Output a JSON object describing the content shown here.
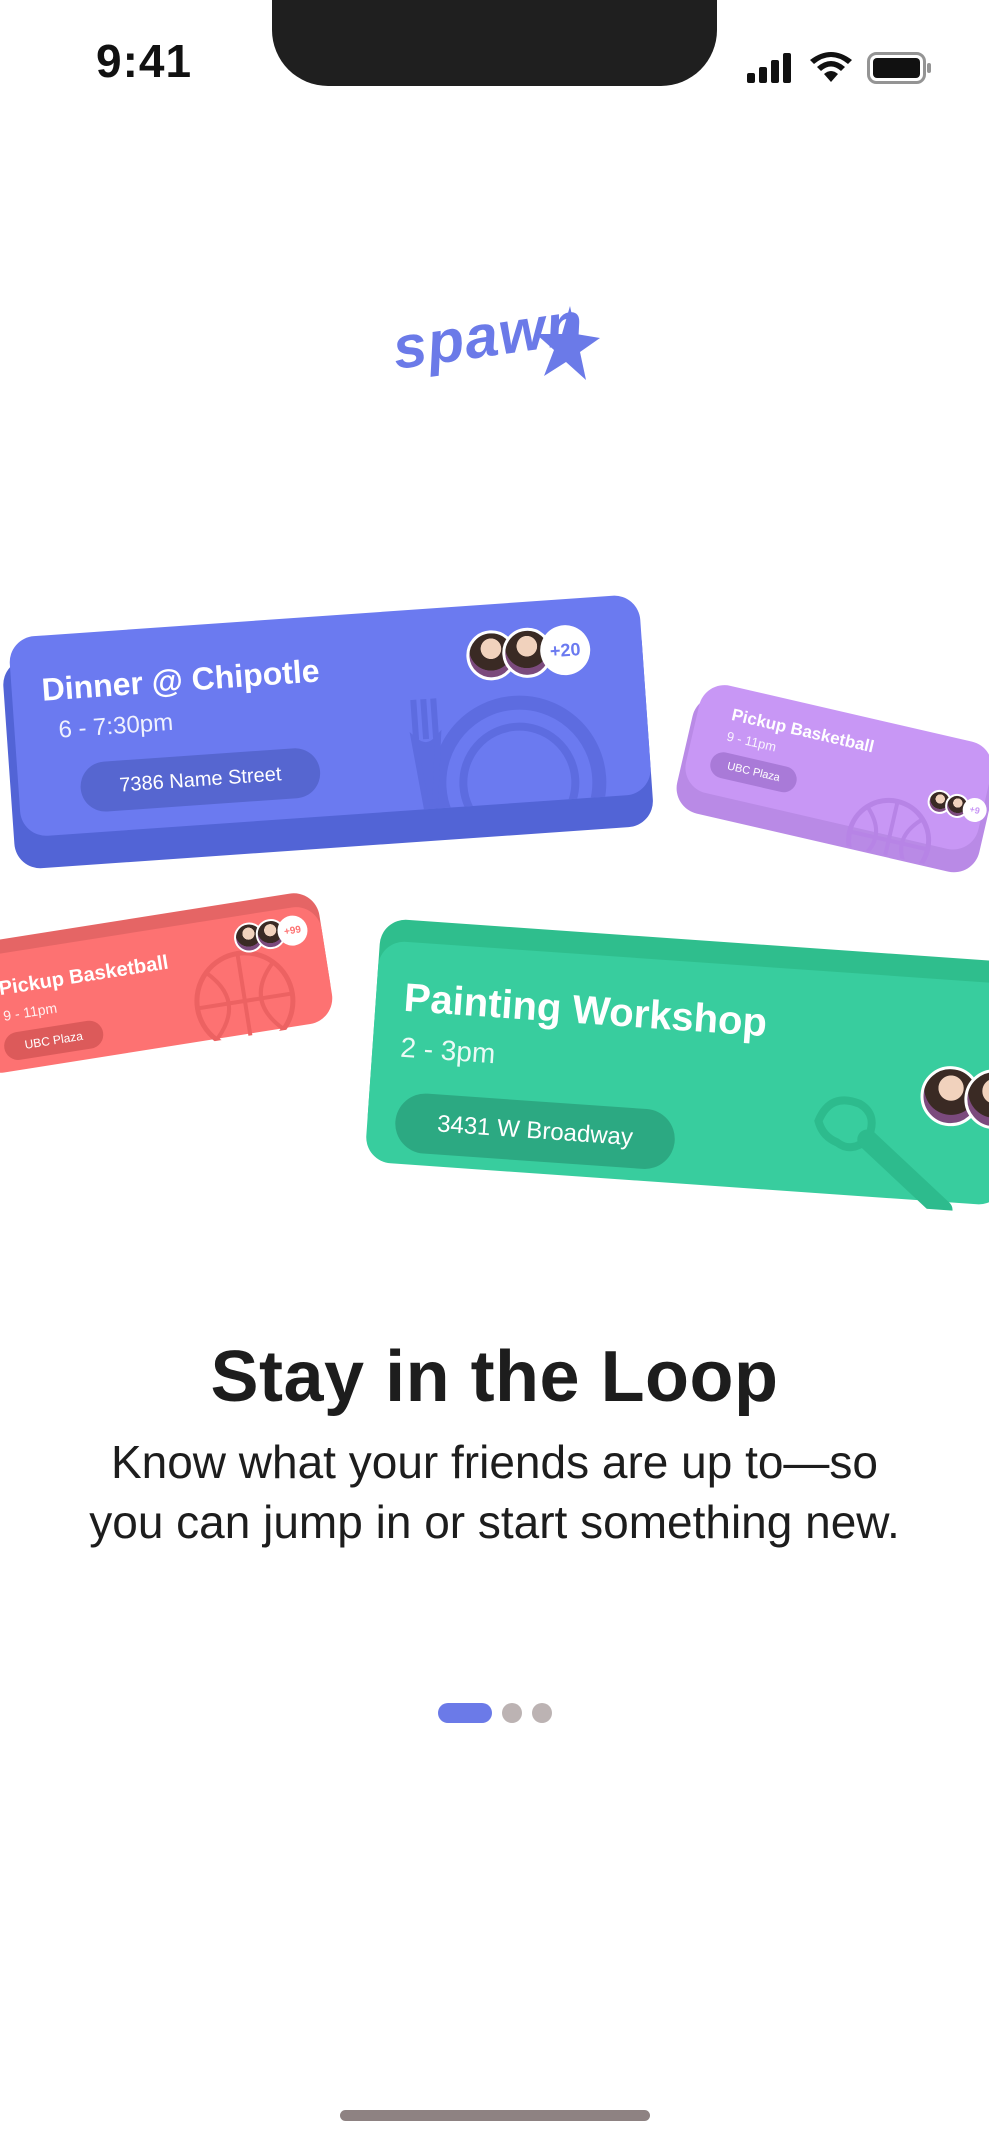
{
  "status_bar": {
    "time": "9:41"
  },
  "logo": {
    "text": "spawn"
  },
  "cards": [
    {
      "title": "Dinner @ Chipotle",
      "time": "6 - 7:30pm",
      "location": "7386 Name Street",
      "extra_count": "+20",
      "color": "#6b7af0",
      "icon": "dinner-plate-icon"
    },
    {
      "title": "Pickup Basketball",
      "time": "9 - 11pm",
      "location": "UBC Plaza",
      "extra_count": "+9",
      "color": "#c897f5",
      "icon": "basketball-icon"
    },
    {
      "title": "Pickup Basketball",
      "time": "9 - 11pm",
      "location": "UBC Plaza",
      "extra_count": "+99",
      "color": "#fd7272",
      "icon": "basketball-icon"
    },
    {
      "title": "Painting Workshop",
      "time": "2 - 3pm",
      "location": "3431 W Broadway",
      "color": "#38cd9e",
      "icon": "paintbrush-icon"
    }
  ],
  "onboarding": {
    "headline": "Stay in the Loop",
    "subtext": "Know what your friends are up to—so you can jump in or start something new.",
    "page_count": 3,
    "current_page": 1
  },
  "colors": {
    "accent": "#6b7ae8",
    "pager_inactive": "#bcb3b3",
    "text": "#1d1d1d"
  }
}
